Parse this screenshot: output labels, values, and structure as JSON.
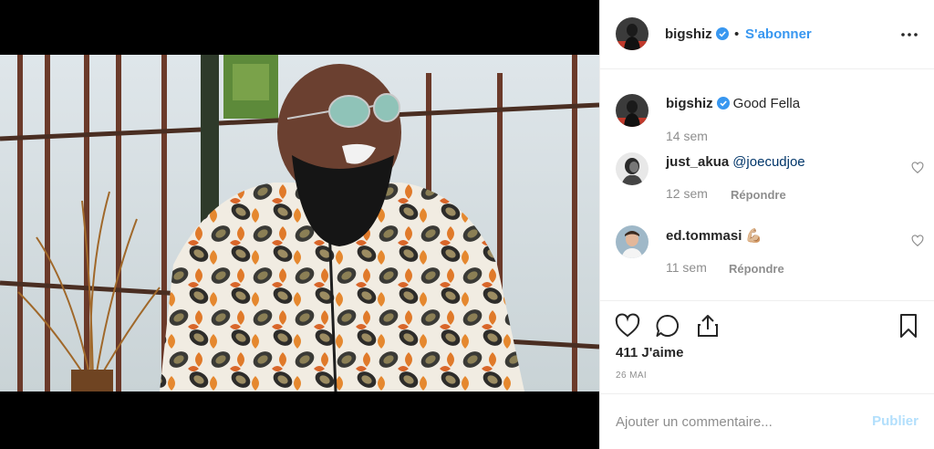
{
  "header": {
    "username": "bigshiz",
    "separator": "•",
    "follow_label": "S'abonner"
  },
  "comments": [
    {
      "username": "bigshiz",
      "text": "Good Fella",
      "time": "14 sem"
    },
    {
      "username": "just_akua",
      "mention": "@joecudjoe",
      "time": "12 sem",
      "reply_label": "Répondre"
    },
    {
      "username": "ed.tommasi",
      "emoji": "💪🏼",
      "time": "11 sem",
      "reply_label": "Répondre"
    }
  ],
  "actions": {
    "likes": "411 J'aime",
    "date": "26 MAI"
  },
  "add_comment": {
    "placeholder": "Ajouter un commentaire...",
    "publish_label": "Publier"
  },
  "icons": {
    "verified": "verified-badge-icon",
    "more": "more-options-icon",
    "like": "heart-icon",
    "comment": "comment-bubble-icon",
    "share": "share-icon",
    "save": "bookmark-icon"
  },
  "colors": {
    "link": "#3897f0",
    "mention": "#003569",
    "muted": "#8e8e8e",
    "publish_disabled": "#b2dffc"
  }
}
